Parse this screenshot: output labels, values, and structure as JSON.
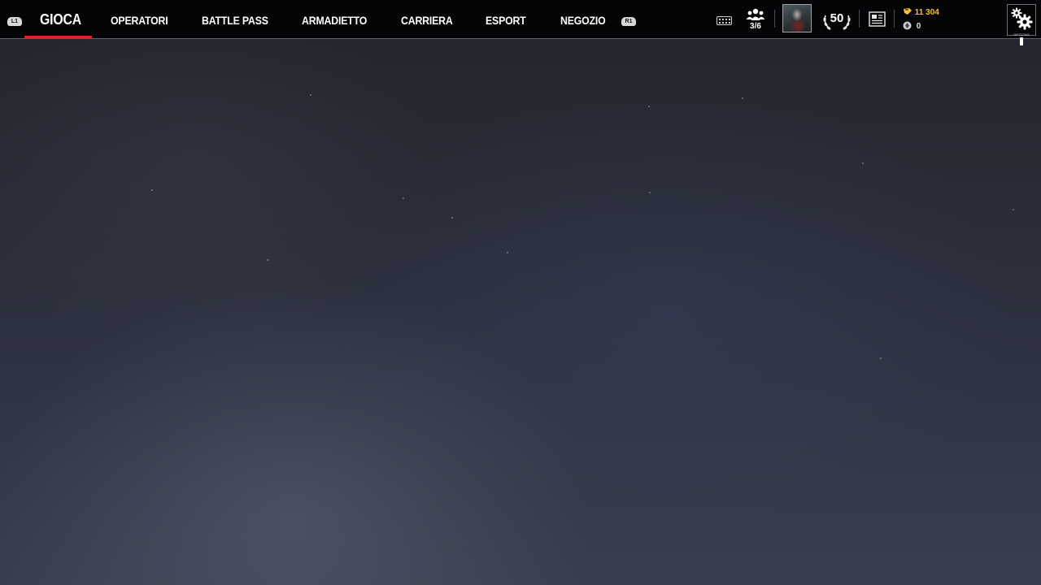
{
  "nav": {
    "left_shoulder": "L1",
    "right_shoulder": "R1",
    "tabs": [
      {
        "label": "GIOCA",
        "active": true
      },
      {
        "label": "OPERATORI",
        "active": false
      },
      {
        "label": "BATTLE PASS",
        "active": false
      },
      {
        "label": "ARMADIETTO",
        "active": false
      },
      {
        "label": "CARRIERA",
        "active": false
      },
      {
        "label": "ESPORT",
        "active": false
      },
      {
        "label": "NEGOZIO",
        "active": false
      }
    ],
    "active_color": "#d7262e"
  },
  "status": {
    "party_count": "3/6",
    "level": "50",
    "renown": "11 304",
    "r6_credits": "0",
    "renown_color": "#f2c230",
    "settings_label": "OPTIONS"
  },
  "icons": {
    "keyboard": "keyboard-icon",
    "party": "party-icon",
    "news": "news-icon",
    "renown": "renown-icon",
    "credits": "r6-credits-icon",
    "settings": "gear-icon"
  }
}
